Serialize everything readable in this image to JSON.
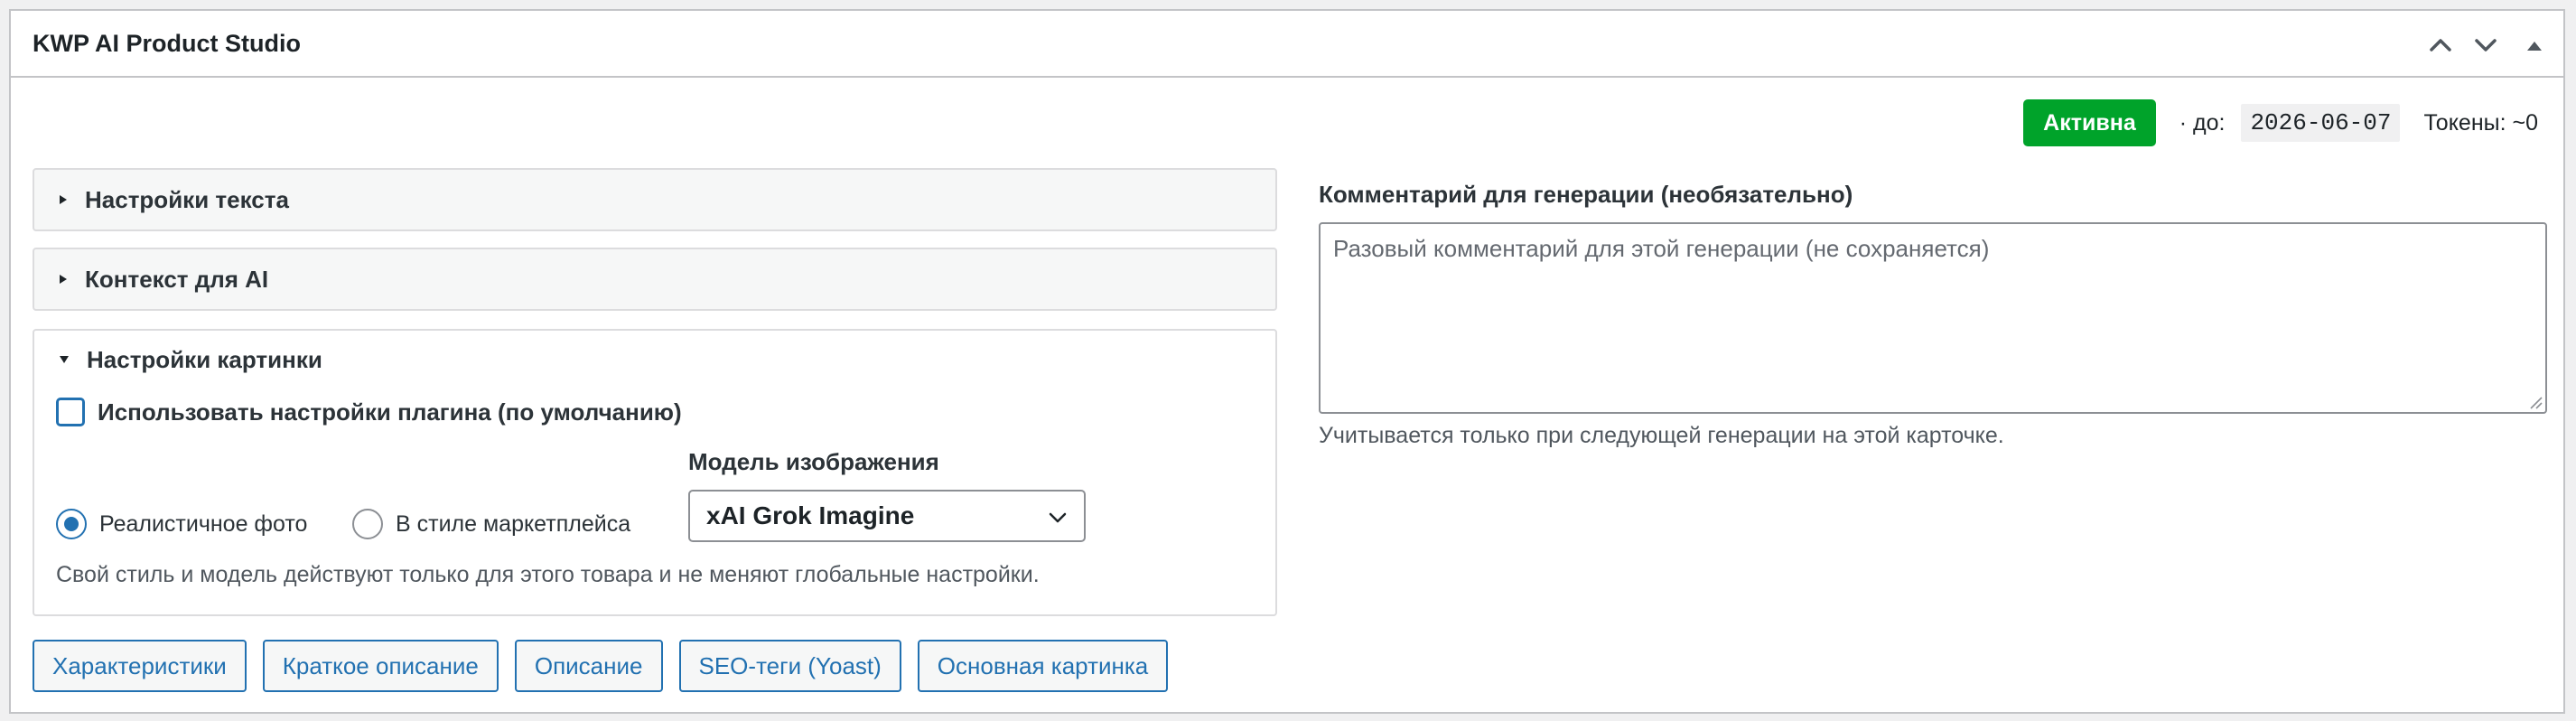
{
  "panel": {
    "title": "KWP AI Product Studio"
  },
  "status": {
    "badge": "Активна",
    "until_label": "· до:",
    "date": "2026-06-07",
    "tokens": "Токены: ~0",
    "badge_color": "#00a32a"
  },
  "sections": {
    "text_settings": {
      "label": "Настройки текста",
      "expanded": false
    },
    "ai_context": {
      "label": "Контекст для AI",
      "expanded": false
    },
    "image_settings": {
      "label": "Настройки картинки",
      "expanded": true,
      "use_plugin_defaults_label": "Использовать настройки плагина (по умолчанию)",
      "use_plugin_defaults_checked": false,
      "style_options": [
        {
          "label": "Реалистичное фото",
          "checked": true
        },
        {
          "label": "В стиле маркетплейса",
          "checked": false
        }
      ],
      "model_label": "Модель изображения",
      "model_value": "xAI Grok Imagine",
      "hint": "Свой стиль и модель действуют только для этого товара и не меняют глобальные настройки."
    }
  },
  "comment": {
    "label": "Комментарий для генерации (необязательно)",
    "placeholder": "Разовый комментарий для этой генерации (не сохраняется)",
    "value": "",
    "hint": "Учитывается только при следующей генерации на этой карточке."
  },
  "actions": {
    "specs": "Характеристики",
    "short_description": "Краткое описание",
    "description": "Описание",
    "seo_tags": "SEO-теги (Yoast)",
    "main_image": "Основная картинка"
  },
  "colors": {
    "accent": "#2271b1",
    "border": "#c3c4c7"
  }
}
